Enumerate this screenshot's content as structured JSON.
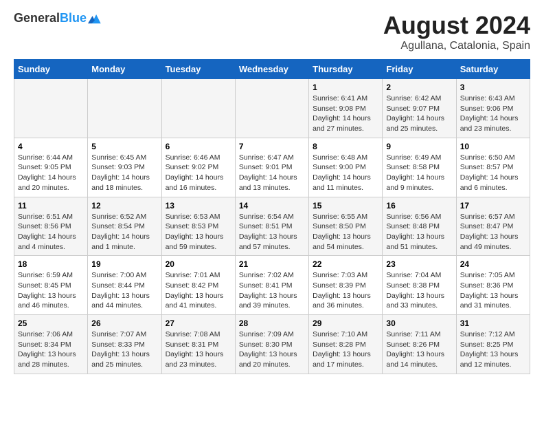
{
  "logo": {
    "general": "General",
    "blue": "Blue"
  },
  "header": {
    "title": "August 2024",
    "subtitle": "Agullana, Catalonia, Spain"
  },
  "weekdays": [
    "Sunday",
    "Monday",
    "Tuesday",
    "Wednesday",
    "Thursday",
    "Friday",
    "Saturday"
  ],
  "weeks": [
    [
      {
        "day": "",
        "detail": ""
      },
      {
        "day": "",
        "detail": ""
      },
      {
        "day": "",
        "detail": ""
      },
      {
        "day": "",
        "detail": ""
      },
      {
        "day": "1",
        "detail": "Sunrise: 6:41 AM\nSunset: 9:08 PM\nDaylight: 14 hours\nand 27 minutes."
      },
      {
        "day": "2",
        "detail": "Sunrise: 6:42 AM\nSunset: 9:07 PM\nDaylight: 14 hours\nand 25 minutes."
      },
      {
        "day": "3",
        "detail": "Sunrise: 6:43 AM\nSunset: 9:06 PM\nDaylight: 14 hours\nand 23 minutes."
      }
    ],
    [
      {
        "day": "4",
        "detail": "Sunrise: 6:44 AM\nSunset: 9:05 PM\nDaylight: 14 hours\nand 20 minutes."
      },
      {
        "day": "5",
        "detail": "Sunrise: 6:45 AM\nSunset: 9:03 PM\nDaylight: 14 hours\nand 18 minutes."
      },
      {
        "day": "6",
        "detail": "Sunrise: 6:46 AM\nSunset: 9:02 PM\nDaylight: 14 hours\nand 16 minutes."
      },
      {
        "day": "7",
        "detail": "Sunrise: 6:47 AM\nSunset: 9:01 PM\nDaylight: 14 hours\nand 13 minutes."
      },
      {
        "day": "8",
        "detail": "Sunrise: 6:48 AM\nSunset: 9:00 PM\nDaylight: 14 hours\nand 11 minutes."
      },
      {
        "day": "9",
        "detail": "Sunrise: 6:49 AM\nSunset: 8:58 PM\nDaylight: 14 hours\nand 9 minutes."
      },
      {
        "day": "10",
        "detail": "Sunrise: 6:50 AM\nSunset: 8:57 PM\nDaylight: 14 hours\nand 6 minutes."
      }
    ],
    [
      {
        "day": "11",
        "detail": "Sunrise: 6:51 AM\nSunset: 8:56 PM\nDaylight: 14 hours\nand 4 minutes."
      },
      {
        "day": "12",
        "detail": "Sunrise: 6:52 AM\nSunset: 8:54 PM\nDaylight: 14 hours\nand 1 minute."
      },
      {
        "day": "13",
        "detail": "Sunrise: 6:53 AM\nSunset: 8:53 PM\nDaylight: 13 hours\nand 59 minutes."
      },
      {
        "day": "14",
        "detail": "Sunrise: 6:54 AM\nSunset: 8:51 PM\nDaylight: 13 hours\nand 57 minutes."
      },
      {
        "day": "15",
        "detail": "Sunrise: 6:55 AM\nSunset: 8:50 PM\nDaylight: 13 hours\nand 54 minutes."
      },
      {
        "day": "16",
        "detail": "Sunrise: 6:56 AM\nSunset: 8:48 PM\nDaylight: 13 hours\nand 51 minutes."
      },
      {
        "day": "17",
        "detail": "Sunrise: 6:57 AM\nSunset: 8:47 PM\nDaylight: 13 hours\nand 49 minutes."
      }
    ],
    [
      {
        "day": "18",
        "detail": "Sunrise: 6:59 AM\nSunset: 8:45 PM\nDaylight: 13 hours\nand 46 minutes."
      },
      {
        "day": "19",
        "detail": "Sunrise: 7:00 AM\nSunset: 8:44 PM\nDaylight: 13 hours\nand 44 minutes."
      },
      {
        "day": "20",
        "detail": "Sunrise: 7:01 AM\nSunset: 8:42 PM\nDaylight: 13 hours\nand 41 minutes."
      },
      {
        "day": "21",
        "detail": "Sunrise: 7:02 AM\nSunset: 8:41 PM\nDaylight: 13 hours\nand 39 minutes."
      },
      {
        "day": "22",
        "detail": "Sunrise: 7:03 AM\nSunset: 8:39 PM\nDaylight: 13 hours\nand 36 minutes."
      },
      {
        "day": "23",
        "detail": "Sunrise: 7:04 AM\nSunset: 8:38 PM\nDaylight: 13 hours\nand 33 minutes."
      },
      {
        "day": "24",
        "detail": "Sunrise: 7:05 AM\nSunset: 8:36 PM\nDaylight: 13 hours\nand 31 minutes."
      }
    ],
    [
      {
        "day": "25",
        "detail": "Sunrise: 7:06 AM\nSunset: 8:34 PM\nDaylight: 13 hours\nand 28 minutes."
      },
      {
        "day": "26",
        "detail": "Sunrise: 7:07 AM\nSunset: 8:33 PM\nDaylight: 13 hours\nand 25 minutes."
      },
      {
        "day": "27",
        "detail": "Sunrise: 7:08 AM\nSunset: 8:31 PM\nDaylight: 13 hours\nand 23 minutes."
      },
      {
        "day": "28",
        "detail": "Sunrise: 7:09 AM\nSunset: 8:30 PM\nDaylight: 13 hours\nand 20 minutes."
      },
      {
        "day": "29",
        "detail": "Sunrise: 7:10 AM\nSunset: 8:28 PM\nDaylight: 13 hours\nand 17 minutes."
      },
      {
        "day": "30",
        "detail": "Sunrise: 7:11 AM\nSunset: 8:26 PM\nDaylight: 13 hours\nand 14 minutes."
      },
      {
        "day": "31",
        "detail": "Sunrise: 7:12 AM\nSunset: 8:25 PM\nDaylight: 13 hours\nand 12 minutes."
      }
    ]
  ]
}
